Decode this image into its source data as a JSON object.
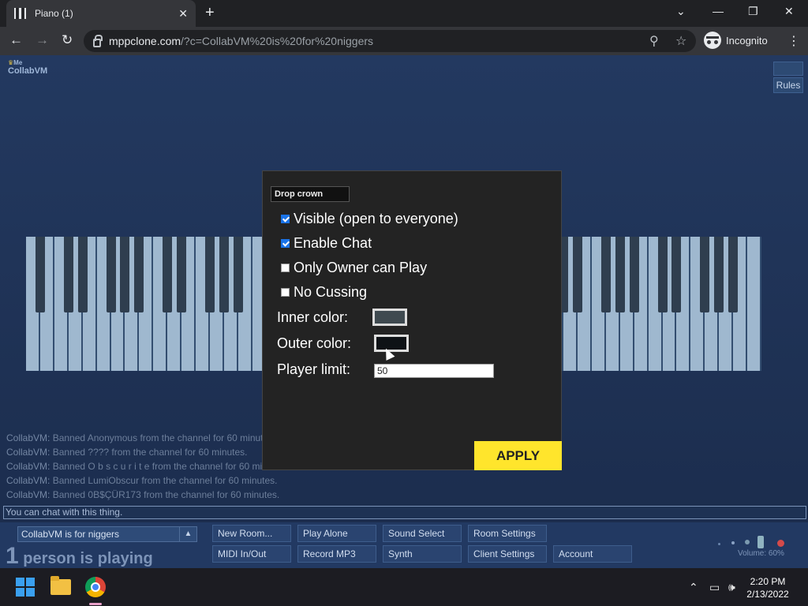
{
  "browser": {
    "tab_title": "Piano (1)",
    "tab_close": "✕",
    "new_tab": "+",
    "url_host": "mppclone.com",
    "url_path": "/?c=CollabVM%20is%20for%20niggers",
    "incognito_label": "Incognito",
    "window_controls": [
      "⌄",
      "—",
      "❐",
      "✕"
    ]
  },
  "page": {
    "logo_small": "Me",
    "logo_text": "CollabVM",
    "rules_label": "Rules"
  },
  "piano": {
    "white_key_count": 52,
    "white_color": "#9fb8cf",
    "black_color": "#2f3e4f"
  },
  "chat": {
    "log": [
      {
        "name": "CollabVM:",
        "text": " Banned Anonymous from the channel for 60 minutes."
      },
      {
        "name": "CollabVM:",
        "text": " Banned ???? from the channel for 60 minutes."
      },
      {
        "name": "CollabVM:",
        "text": " Banned O b s c u r i t e from the channel for 60 minutes."
      },
      {
        "name": "CollabVM:",
        "text": " Banned LumiObscur from the channel for 60 minutes."
      },
      {
        "name": "CollabVM:",
        "text": " Banned 0B$ÇÜR173 from the channel for 60 minutes."
      }
    ],
    "placeholder": "You can chat with this thing."
  },
  "bottom": {
    "room_name": "CollabVM is for niggers",
    "room_arrow": "▲",
    "player_count": "1",
    "player_text": " person is playing",
    "buttons_row1": [
      "New Room...",
      "Play Alone",
      "Sound Select",
      "Room Settings"
    ],
    "buttons_row2": [
      "MIDI In/Out",
      "Record MP3",
      "Synth",
      "Client Settings",
      "Account"
    ],
    "volume_label": "Volume: 60%"
  },
  "modal": {
    "drop_crown": "Drop crown",
    "options": [
      {
        "label": "Visible (open to everyone)",
        "checked": true
      },
      {
        "label": "Enable Chat",
        "checked": true
      },
      {
        "label": "Only Owner can Play",
        "checked": false
      },
      {
        "label": "No Cussing",
        "checked": false
      }
    ],
    "inner_color_label": "Inner color:",
    "inner_color": "#3f4a50",
    "outer_color_label": "Outer color:",
    "outer_color": "#0e1216",
    "player_limit_label": "Player limit:",
    "player_limit_value": "50",
    "apply_label": "APPLY",
    "apply_color": "#ffe52c"
  },
  "taskbar": {
    "time": "2:20 PM",
    "date": "2/13/2022",
    "tray_icons": [
      "chevron-up-icon",
      "display-icon",
      "speaker-icon"
    ]
  }
}
